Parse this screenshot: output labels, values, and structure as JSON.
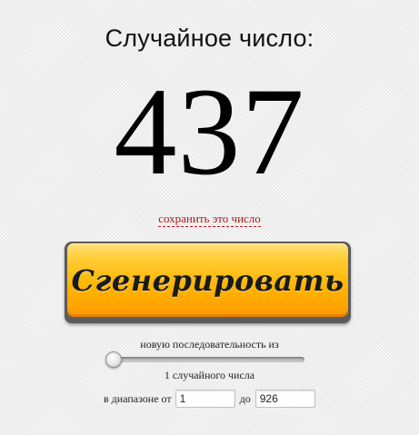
{
  "title": "Случайное число:",
  "number": "437",
  "save_link": "сохранить это число",
  "generate_button": "Сгенерировать",
  "sequence": {
    "label": "новую последовательность из",
    "count_text": "1 случайного числа",
    "slider_level": 0
  },
  "range": {
    "from_label": "в диапазоне от",
    "from_value": "1",
    "to_label": "до",
    "to_value": "926"
  },
  "colors": {
    "button_top": "#ffe27a",
    "button_bottom": "#ff9a00",
    "link": "#b21b1b",
    "background": "#efefef"
  }
}
